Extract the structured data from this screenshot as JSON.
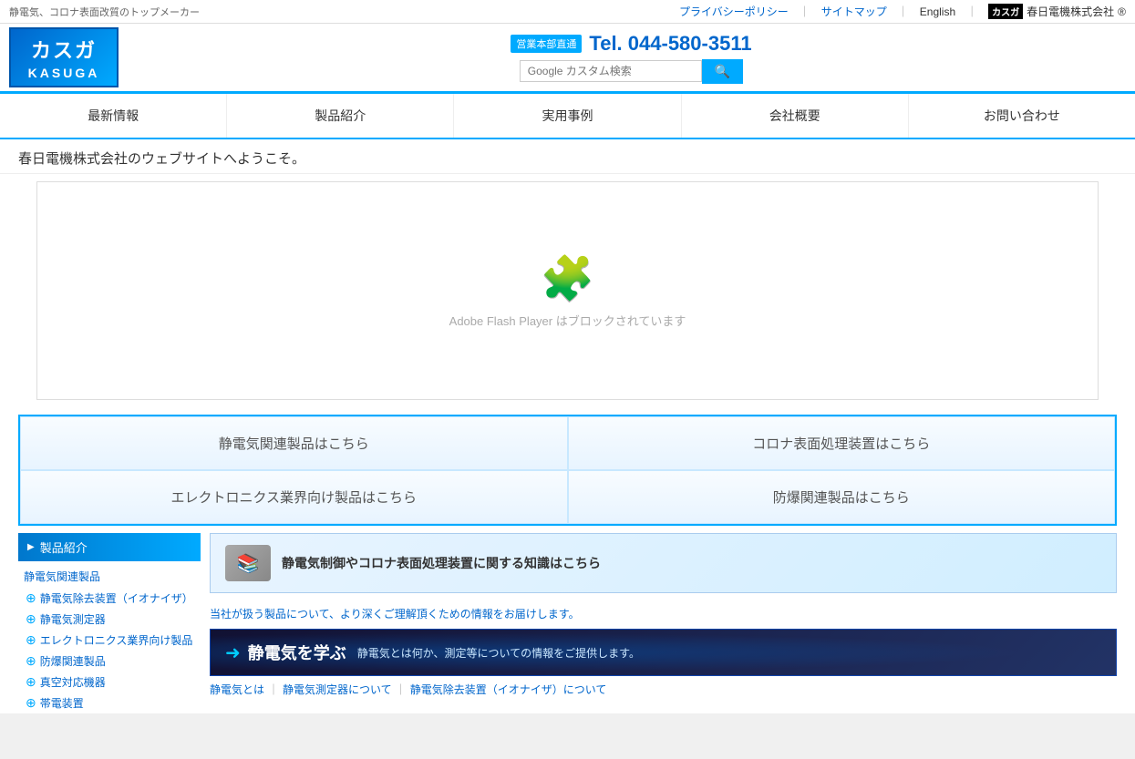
{
  "topbar": {
    "tagline": "静電気、コロナ表面改質のトップメーカー",
    "privacy_policy": "プライバシーポリシー",
    "sitemap": "サイトマップ",
    "english": "English",
    "company_name": "春日電機株式会社",
    "company_badge": "カスガ",
    "registered": "®"
  },
  "header": {
    "logo_katakana": "カスガ",
    "logo_roman": "KASUGA",
    "sales_badge": "営業本部直通",
    "phone": "Tel. 044-580-3511",
    "search_placeholder": "Google カスタム検索",
    "search_icon": "🔍"
  },
  "nav": {
    "items": [
      {
        "label": "最新情報"
      },
      {
        "label": "製品紹介"
      },
      {
        "label": "実用事例"
      },
      {
        "label": "会社概要"
      },
      {
        "label": "お問い合わせ"
      }
    ]
  },
  "welcome": {
    "text": "春日電機株式会社のウェブサイトへようこそ。"
  },
  "flash": {
    "message": "Adobe Flash Player はブロックされています",
    "icon": "🧩"
  },
  "product_buttons": [
    {
      "label": "静電気関連製品はこちら"
    },
    {
      "label": "コロナ表面処理装置はこちら"
    },
    {
      "label": "エレクトロニクス業界向け製品はこちら"
    },
    {
      "label": "防爆関連製品はこちら"
    }
  ],
  "sidebar": {
    "title": "製品紹介",
    "sections": [
      {
        "title": "静電気関連製品",
        "items": [
          "静電気除去装置（イオナイザ）",
          "静電気測定器",
          "エレクトロニクス業界向け製品",
          "防爆関連製品",
          "真空対応機器",
          "帯電装置"
        ]
      }
    ]
  },
  "knowledge": {
    "banner_text_bold": "静電気制御やコロナ表面処理装置",
    "banner_text_rest": "に関する知識はこちら",
    "intro": "当社が扱う製品について、より深くご理解頂くための情報をお届けします。"
  },
  "learn": {
    "arrow": "➜",
    "title": "静電気を学ぶ",
    "subtitle": "静電気とは何か、測定等についての情報をご提供します。"
  },
  "static_links": [
    "静電気とは",
    "静電気測定器について",
    "静電気除去装置（イオナイザ）について"
  ]
}
